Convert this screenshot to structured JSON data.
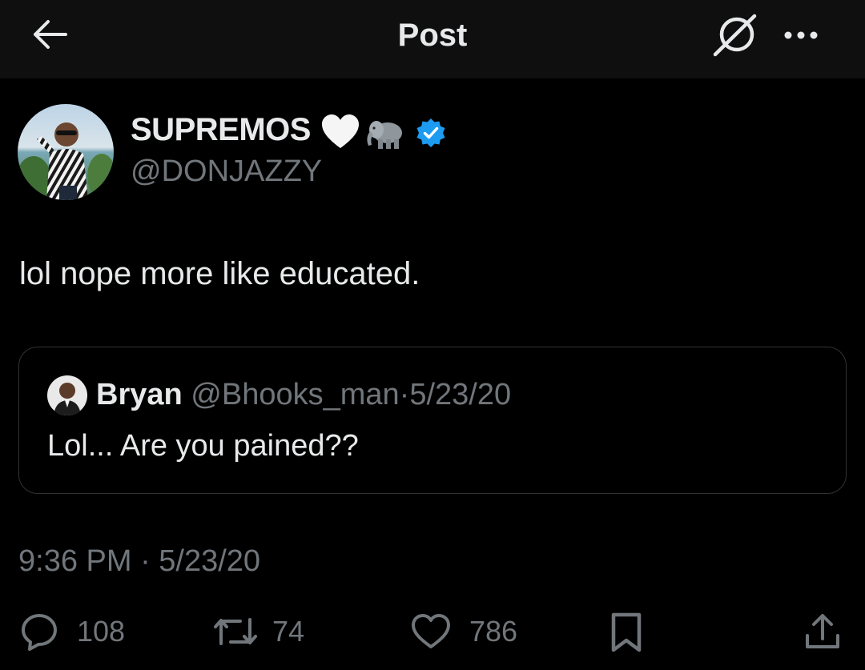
{
  "header": {
    "title": "Post",
    "back_icon": "arrow-left-icon",
    "grok_icon": "grok-icon",
    "more_icon": "more-dots-icon"
  },
  "post": {
    "author_name": "SUPREMOS",
    "name_emojis": [
      "white-heart",
      "elephant"
    ],
    "verified": true,
    "handle": "@DONJAZZY",
    "text": "lol nope more like educated.",
    "timestamp": "9:36 PM · 5/23/20"
  },
  "quote": {
    "name": "Bryan",
    "handle": "@Bhooks_man",
    "separator": "·",
    "date": "5/23/20",
    "text": "Lol... Are you pained??"
  },
  "actions": {
    "replies": "108",
    "reposts": "74",
    "likes": "786"
  },
  "colors": {
    "background": "#000000",
    "header_bg": "#0f0f0f",
    "primary_text": "#e7e9ea",
    "secondary_text": "#71767b",
    "verified_blue": "#1d9bf0",
    "border": "#2f3336"
  }
}
